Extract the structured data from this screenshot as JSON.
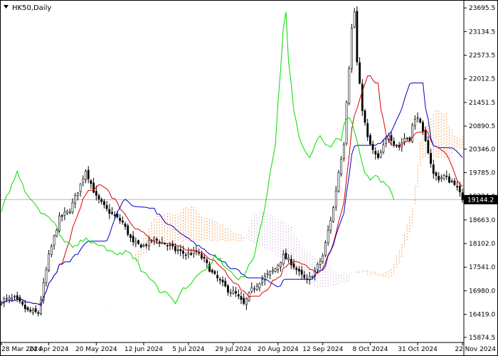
{
  "chart_data": {
    "type": "candlestick",
    "symbol": "HK50",
    "timeframe": "Daily",
    "title": "HK50,Daily",
    "current_price": 19144.2,
    "current_price_label": "19144.2",
    "y_ticks": [
      "23695.5",
      "23134.5",
      "22573.5",
      "22012.5",
      "21451.5",
      "20890.5",
      "20346.0",
      "19785.0",
      "19224.0",
      "18663.0",
      "18102.0",
      "17541.0",
      "16980.0",
      "16419.0",
      "15874.5"
    ],
    "y_tick_values": [
      23695.5,
      23134.5,
      22573.5,
      22012.5,
      21451.5,
      20890.5,
      20346.0,
      19785.0,
      19224.0,
      18663.0,
      18102.0,
      17541.0,
      16980.0,
      16419.0,
      15874.5
    ],
    "x_ticks": [
      "28 Mar 2024",
      "24 Apr 2024",
      "20 May 2024",
      "12 Jun 2024",
      "5 Jul 2024",
      "29 Jul 2024",
      "20 Aug 2024",
      "12 Sep 2024",
      "8 Oct 2024",
      "31 Oct 2024",
      "22 Nov 2024"
    ],
    "x_tick_index": [
      0,
      18,
      36,
      54,
      71,
      88,
      105,
      122,
      140,
      158,
      175
    ],
    "ylim": [
      15770,
      23850
    ],
    "n_candles": 176,
    "shift": 26,
    "close_points": [
      [
        0,
        16750
      ],
      [
        5,
        16800
      ],
      [
        10,
        16500
      ],
      [
        14,
        16450
      ],
      [
        18,
        17800
      ],
      [
        22,
        18700
      ],
      [
        26,
        18900
      ],
      [
        30,
        19500
      ],
      [
        32,
        19850
      ],
      [
        36,
        19200
      ],
      [
        40,
        18900
      ],
      [
        43,
        18750
      ],
      [
        46,
        18600
      ],
      [
        50,
        18100
      ],
      [
        54,
        18050
      ],
      [
        58,
        18200
      ],
      [
        62,
        18100
      ],
      [
        66,
        17950
      ],
      [
        70,
        17850
      ],
      [
        74,
        17900
      ],
      [
        77,
        17700
      ],
      [
        80,
        17400
      ],
      [
        83,
        17200
      ],
      [
        86,
        17000
      ],
      [
        89,
        16900
      ],
      [
        92,
        16650
      ],
      [
        95,
        17000
      ],
      [
        98,
        17200
      ],
      [
        101,
        17350
      ],
      [
        104,
        17500
      ],
      [
        107,
        17800
      ],
      [
        110,
        17650
      ],
      [
        113,
        17400
      ],
      [
        116,
        17200
      ],
      [
        119,
        17450
      ],
      [
        122,
        17800
      ],
      [
        124,
        18400
      ],
      [
        126,
        18950
      ],
      [
        128,
        19800
      ],
      [
        130,
        20500
      ],
      [
        131,
        21500
      ],
      [
        132,
        22300
      ],
      [
        133,
        23200
      ],
      [
        134,
        23600
      ],
      [
        135,
        22400
      ],
      [
        137,
        21300
      ],
      [
        139,
        20600
      ],
      [
        141,
        20300
      ],
      [
        143,
        20100
      ],
      [
        145,
        20400
      ],
      [
        147,
        20700
      ],
      [
        149,
        20500
      ],
      [
        151,
        20400
      ],
      [
        153,
        20600
      ],
      [
        155,
        20600
      ],
      [
        156,
        20900
      ],
      [
        158,
        21150
      ],
      [
        160,
        20700
      ],
      [
        162,
        20300
      ],
      [
        164,
        19750
      ],
      [
        166,
        19650
      ],
      [
        168,
        19700
      ],
      [
        170,
        19600
      ],
      [
        172,
        19550
      ],
      [
        175,
        19144
      ]
    ],
    "colors": {
      "bull": "#ffffff",
      "bear": "#000000",
      "tenkan": "#dd0000",
      "kijun": "#0000cc",
      "chikou": "#00dd00",
      "kumo_up": "#f4a460",
      "kumo_down": "#d8bfd8",
      "price_line": "#c0c0c0"
    },
    "indicator": "Ichimoku Kinko Hyo"
  }
}
